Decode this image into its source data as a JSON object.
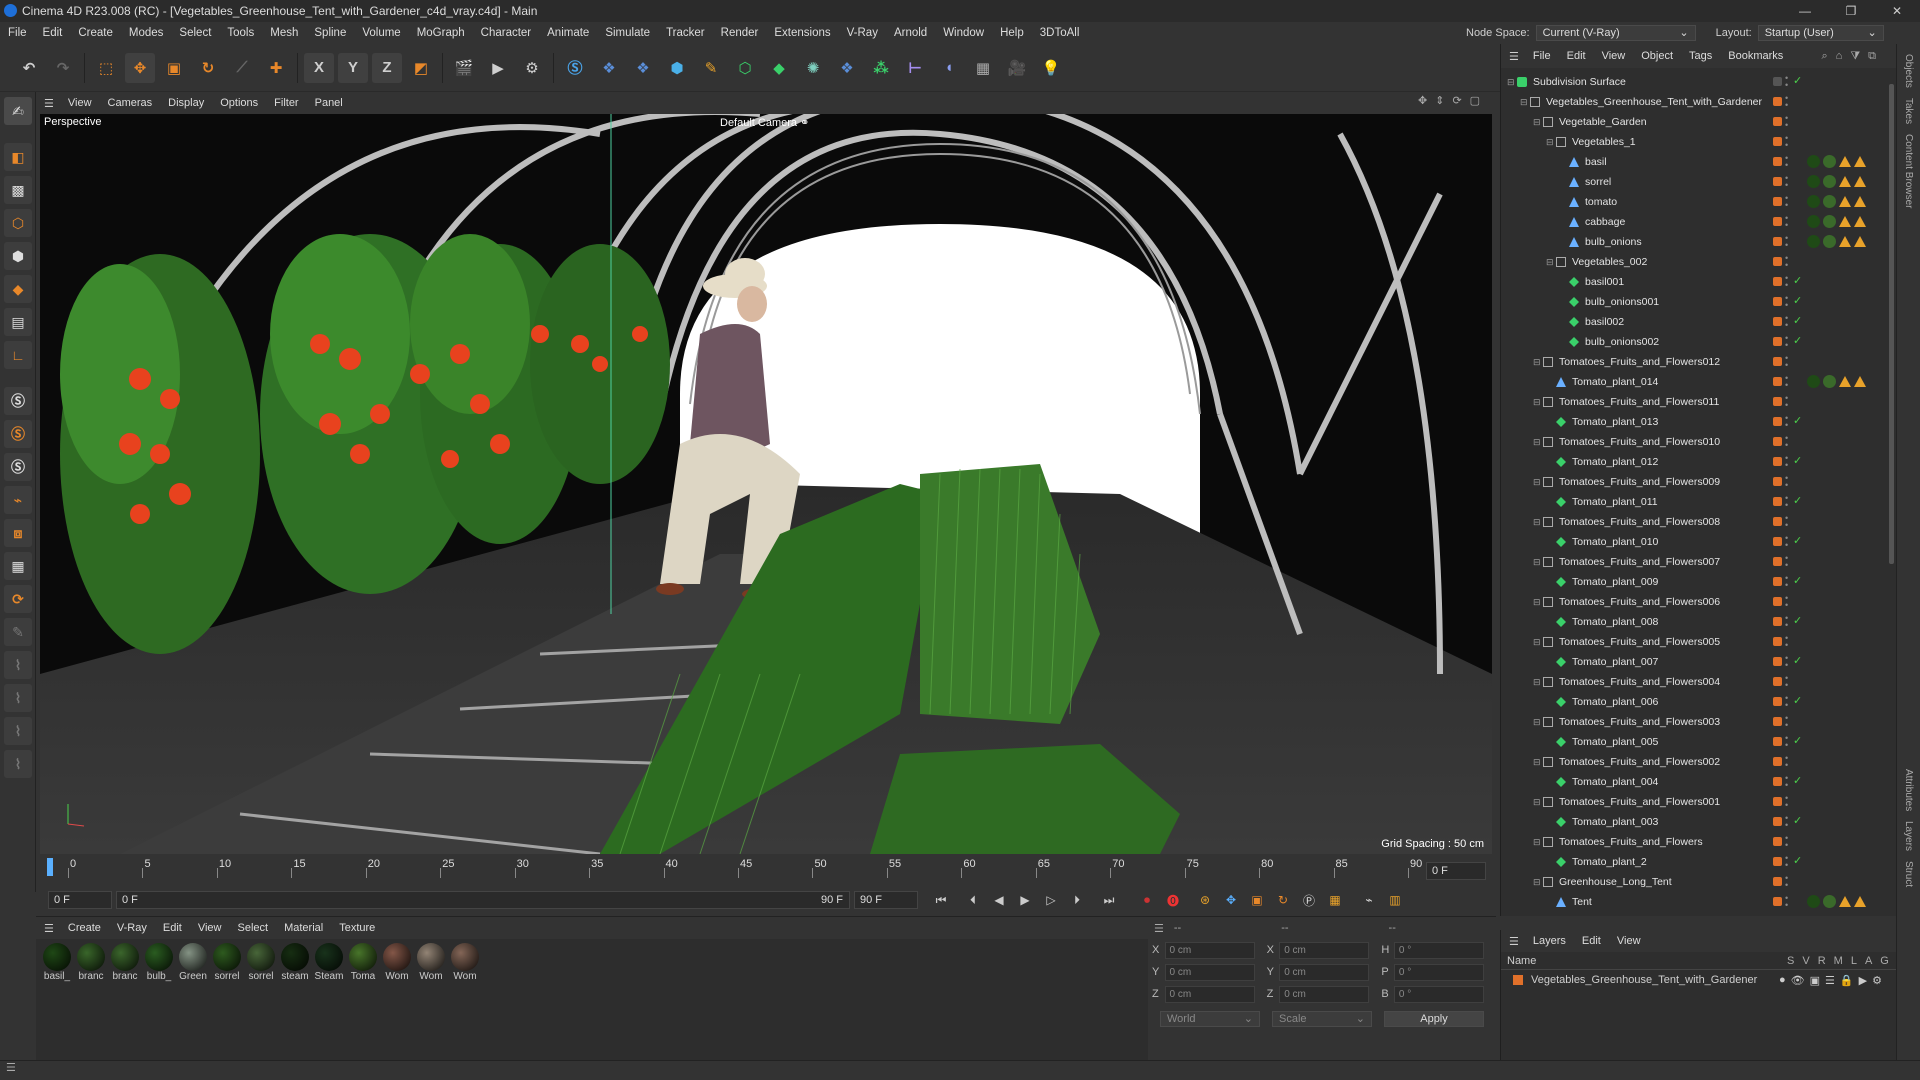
{
  "window": {
    "title": "Cinema 4D R23.008 (RC) - [Vegetables_Greenhouse_Tent_with_Gardener_c4d_vray.c4d] - Main",
    "controls": [
      "—",
      "❐",
      "✕"
    ]
  },
  "menubar": [
    "File",
    "Edit",
    "Create",
    "Modes",
    "Select",
    "Tools",
    "Mesh",
    "Spline",
    "Volume",
    "MoGraph",
    "Character",
    "Animate",
    "Simulate",
    "Tracker",
    "Render",
    "Extensions",
    "V-Ray",
    "Arnold",
    "Window",
    "Help",
    "3DToAll"
  ],
  "nodespace": {
    "label": "Node Space:",
    "value": "Current (V-Ray)",
    "layout_label": "Layout:",
    "layout_value": "Startup (User)"
  },
  "toolbar_letters": [
    "X",
    "Y",
    "Z"
  ],
  "viewport_menu": [
    "View",
    "Cameras",
    "Display",
    "Options",
    "Filter",
    "Panel"
  ],
  "viewport": {
    "name": "Perspective",
    "camera": "Default Camera",
    "grid": "Grid Spacing : 50 cm"
  },
  "timeline": {
    "ticks": [
      "0",
      "5",
      "10",
      "15",
      "20",
      "25",
      "30",
      "35",
      "40",
      "45",
      "50",
      "55",
      "60",
      "65",
      "70",
      "75",
      "80",
      "85",
      "90"
    ],
    "frame_right": "0 F"
  },
  "playbar": {
    "start": "0 F",
    "current": "0 F",
    "end1": "90 F",
    "end2": "90 F"
  },
  "materials": {
    "menu": [
      "Create",
      "V-Ray",
      "Edit",
      "View",
      "Select",
      "Material",
      "Texture"
    ],
    "items": [
      "basil_",
      "branc",
      "branc",
      "bulb_",
      "Green",
      "sorrel",
      "sorrel",
      "steam",
      "Steam",
      "Toma",
      "Wom",
      "Wom",
      "Wom"
    ]
  },
  "coords": {
    "rows": [
      {
        "a": "X",
        "av": "0 cm",
        "b": "X",
        "bv": "0 cm",
        "c": "H",
        "cv": "0 °"
      },
      {
        "a": "Y",
        "av": "0 cm",
        "b": "Y",
        "bv": "0 cm",
        "c": "P",
        "cv": "0 °"
      },
      {
        "a": "Z",
        "av": "0 cm",
        "b": "Z",
        "bv": "0 cm",
        "c": "B",
        "cv": "0 °"
      }
    ],
    "world": "World",
    "scale": "Scale",
    "apply": "Apply"
  },
  "objects": {
    "menu": [
      "File",
      "Edit",
      "View",
      "Object",
      "Tags",
      "Bookmarks"
    ],
    "rows": [
      {
        "name": "Subdivision Surface",
        "depth": 0
      },
      {
        "name": "Vegetables_Greenhouse_Tent_with_Gardener",
        "depth": 1
      },
      {
        "name": "Vegetable_Garden",
        "depth": 2
      },
      {
        "name": "Vegetables_1",
        "depth": 3
      },
      {
        "name": "basil",
        "depth": 4
      },
      {
        "name": "sorrel",
        "depth": 4
      },
      {
        "name": "tomato",
        "depth": 4
      },
      {
        "name": "cabbage",
        "depth": 4
      },
      {
        "name": "bulb_onions",
        "depth": 4
      },
      {
        "name": "Vegetables_002",
        "depth": 3
      },
      {
        "name": "basil001",
        "depth": 4
      },
      {
        "name": "bulb_onions001",
        "depth": 4
      },
      {
        "name": "basil002",
        "depth": 4
      },
      {
        "name": "bulb_onions002",
        "depth": 4
      },
      {
        "name": "Tomatoes_Fruits_and_Flowers012",
        "depth": 2
      },
      {
        "name": "Tomato_plant_014",
        "depth": 3
      },
      {
        "name": "Tomatoes_Fruits_and_Flowers011",
        "depth": 2
      },
      {
        "name": "Tomato_plant_013",
        "depth": 3
      },
      {
        "name": "Tomatoes_Fruits_and_Flowers010",
        "depth": 2
      },
      {
        "name": "Tomato_plant_012",
        "depth": 3
      },
      {
        "name": "Tomatoes_Fruits_and_Flowers009",
        "depth": 2
      },
      {
        "name": "Tomato_plant_011",
        "depth": 3
      },
      {
        "name": "Tomatoes_Fruits_and_Flowers008",
        "depth": 2
      },
      {
        "name": "Tomato_plant_010",
        "depth": 3
      },
      {
        "name": "Tomatoes_Fruits_and_Flowers007",
        "depth": 2
      },
      {
        "name": "Tomato_plant_009",
        "depth": 3
      },
      {
        "name": "Tomatoes_Fruits_and_Flowers006",
        "depth": 2
      },
      {
        "name": "Tomato_plant_008",
        "depth": 3
      },
      {
        "name": "Tomatoes_Fruits_and_Flowers005",
        "depth": 2
      },
      {
        "name": "Tomato_plant_007",
        "depth": 3
      },
      {
        "name": "Tomatoes_Fruits_and_Flowers004",
        "depth": 2
      },
      {
        "name": "Tomato_plant_006",
        "depth": 3
      },
      {
        "name": "Tomatoes_Fruits_and_Flowers003",
        "depth": 2
      },
      {
        "name": "Tomato_plant_005",
        "depth": 3
      },
      {
        "name": "Tomatoes_Fruits_and_Flowers002",
        "depth": 2
      },
      {
        "name": "Tomato_plant_004",
        "depth": 3
      },
      {
        "name": "Tomatoes_Fruits_and_Flowers001",
        "depth": 2
      },
      {
        "name": "Tomato_plant_003",
        "depth": 3
      },
      {
        "name": "Tomatoes_Fruits_and_Flowers",
        "depth": 2
      },
      {
        "name": "Tomato_plant_2",
        "depth": 3
      },
      {
        "name": "Greenhouse_Long_Tent",
        "depth": 2
      },
      {
        "name": "Tent",
        "depth": 3
      }
    ]
  },
  "layers": {
    "menu": [
      "Layers",
      "Edit",
      "View"
    ],
    "header": "Name",
    "cols": [
      "S",
      "V",
      "R",
      "M",
      "L",
      "A",
      "G"
    ],
    "row": "Vegetables_Greenhouse_Tent_with_Gardener"
  },
  "right_tabs": [
    "Objects",
    "Takes",
    "Content Browser",
    "Attributes",
    "Layers",
    "Struct"
  ],
  "colors": {
    "accent": "#e0702a",
    "check": "#4bd04b",
    "bg": "#333333"
  }
}
